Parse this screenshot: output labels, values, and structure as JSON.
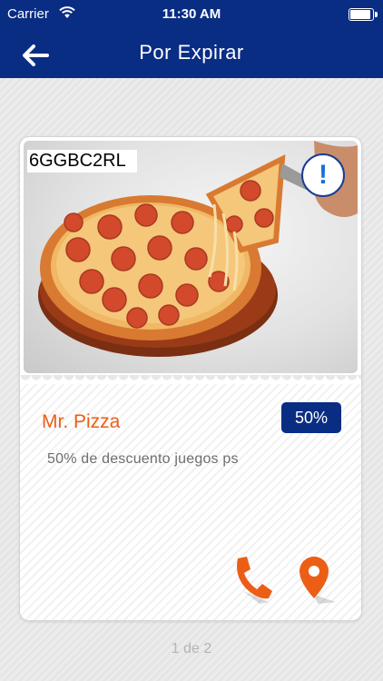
{
  "status_bar": {
    "carrier": "Carrier",
    "time": "11:30 AM",
    "battery_level": 1.0
  },
  "nav": {
    "title": "Por Expirar",
    "back_icon": "arrow-left-icon"
  },
  "coupon": {
    "code": "6GGBC2RL",
    "alert_icon": "exclamation-icon",
    "alert_symbol": "!",
    "merchant": "Mr. Pizza",
    "discount": "50%",
    "description": "50% de descuento juegos ps",
    "actions": {
      "phone_icon": "phone-icon",
      "map_icon": "map-pin-icon"
    }
  },
  "pager": {
    "text": "1 de 2"
  },
  "colors": {
    "brand": "#0a2d84",
    "accent": "#ec5e16"
  }
}
